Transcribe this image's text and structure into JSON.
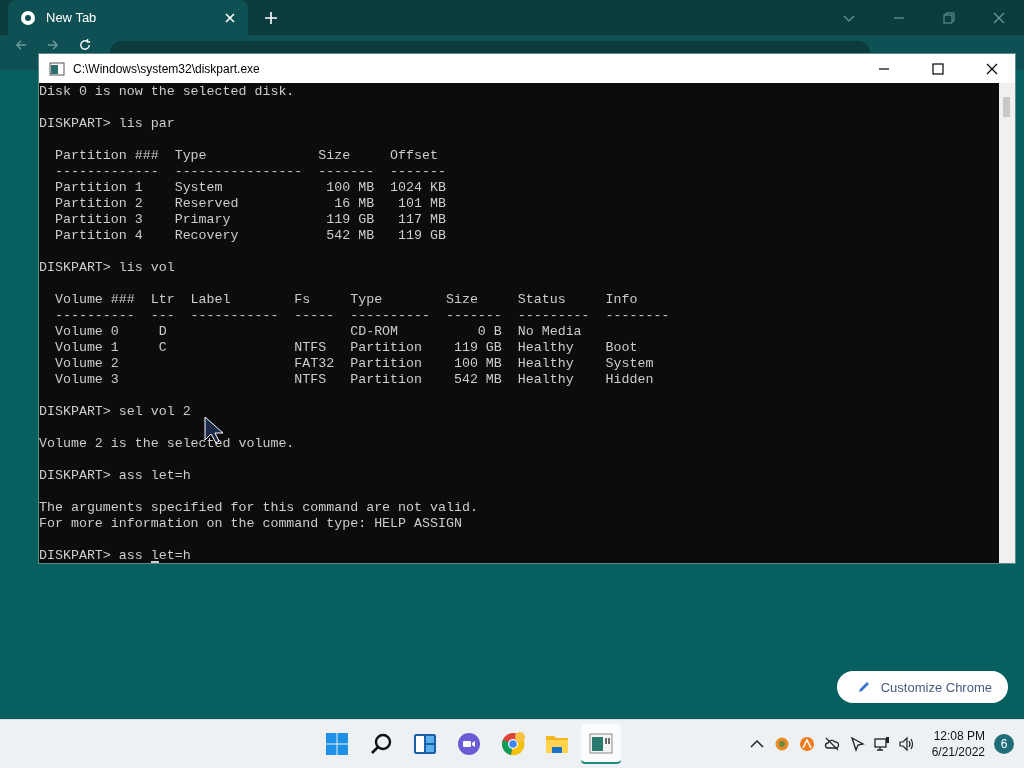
{
  "browser": {
    "tab": {
      "title": "New Tab",
      "selected": true
    }
  },
  "console": {
    "title": "C:\\Windows\\system32\\diskpart.exe",
    "blocks": [
      [
        "Disk 0 is now the selected disk."
      ],
      [
        "DISKPART> lis par"
      ],
      [
        "  Partition ###  Type              Size     Offset",
        "  -------------  ----------------  -------  -------",
        "  Partition 1    System             100 MB  1024 KB",
        "  Partition 2    Reserved            16 MB   101 MB",
        "  Partition 3    Primary            119 GB   117 MB",
        "  Partition 4    Recovery           542 MB   119 GB"
      ],
      [
        "DISKPART> lis vol"
      ],
      [
        "  Volume ###  Ltr  Label        Fs     Type        Size     Status     Info",
        "  ----------  ---  -----------  -----  ----------  -------  ---------  --------",
        "  Volume 0     D                       CD-ROM          0 B  No Media",
        "  Volume 1     C                NTFS   Partition    119 GB  Healthy    Boot",
        "  Volume 2                      FAT32  Partition    100 MB  Healthy    System",
        "  Volume 3                      NTFS   Partition    542 MB  Healthy    Hidden"
      ],
      [
        "DISKPART> sel vol 2"
      ],
      [
        "Volume 2 is the selected volume."
      ],
      [
        "DISKPART> ass let=h"
      ],
      [
        "The arguments specified for this command are not valid.",
        "For more information on the command type: HELP ASSIGN"
      ],
      [
        "DISKPART> ass let=h"
      ]
    ]
  },
  "customize_button": "Customize Chrome",
  "taskbar": {
    "apps": [
      {
        "kind": "start",
        "selected": false
      },
      {
        "kind": "search",
        "selected": false
      },
      {
        "kind": "widgets",
        "selected": false
      },
      {
        "kind": "chat",
        "selected": false
      },
      {
        "kind": "chrome",
        "selected": false
      },
      {
        "kind": "folder",
        "selected": false
      },
      {
        "kind": "console",
        "selected": true
      }
    ],
    "time": "12:08 PM",
    "date": "6/21/2022",
    "notifications": "6"
  }
}
